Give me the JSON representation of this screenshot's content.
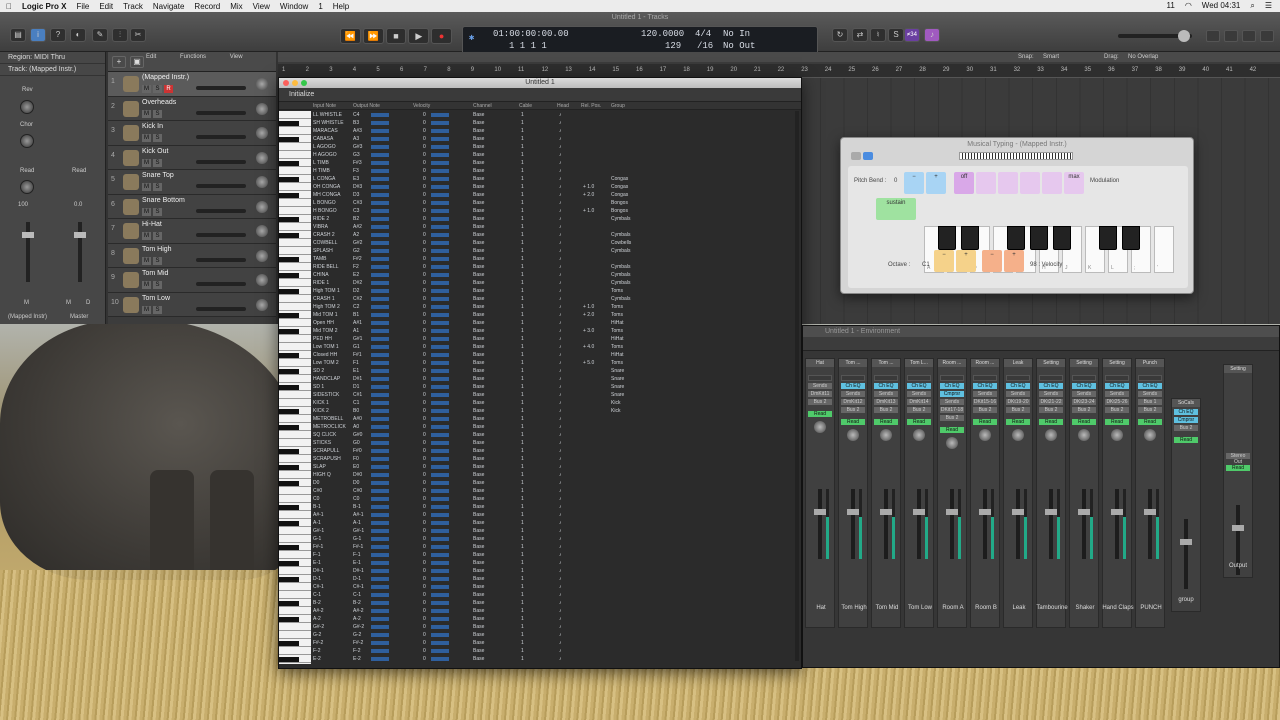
{
  "menubar": {
    "app": "Logic Pro X",
    "items": [
      "File",
      "Edit",
      "Track",
      "Navigate",
      "Record",
      "Mix",
      "View",
      "Window",
      "1",
      "Help"
    ],
    "clock": "Wed 04:31",
    "battery": "11"
  },
  "window_title": "Untitled 1 - Tracks",
  "lcd": {
    "time": "01:00:00:00.00",
    "bars": "1  1  1     1",
    "tempo": "120.0000",
    "division": "129",
    "signature": "4/4",
    "signature_den": "/16",
    "in": "No In",
    "out": "No Out"
  },
  "toolbar": {
    "count": "≠34"
  },
  "transport": [
    "⏪",
    "⏩",
    "■",
    "▶",
    "●"
  ],
  "inspector": {
    "region": "Region: MIDI Thru",
    "track": "Track: (Mapped Instr.)",
    "rev": "Rev",
    "chor": "Chor",
    "read1": "Read",
    "read2": "Read",
    "vol1": "100",
    "vol2": "0.0",
    "name1": "(Mapped Instr)",
    "name2": "Master",
    "m1": "M",
    "m2": "M",
    "d2": "D"
  },
  "arrange_menu": [
    "Edit",
    "Functions",
    "View"
  ],
  "snap": "Snap:",
  "snap_value": "Smart",
  "drag": "Drag:",
  "drag_value": "No Overlap",
  "ruler": [
    "1",
    "2",
    "3",
    "4",
    "5",
    "6",
    "7",
    "8",
    "9",
    "10",
    "11",
    "12",
    "13",
    "14",
    "15",
    "16",
    "17",
    "18",
    "19",
    "20",
    "21",
    "22",
    "23",
    "24",
    "25",
    "26",
    "27",
    "28",
    "29",
    "30",
    "31",
    "32",
    "33",
    "34",
    "35",
    "36",
    "37",
    "38",
    "39",
    "40",
    "41",
    "42"
  ],
  "tracks": [
    {
      "num": "1",
      "name": "(Mapped Instr.)"
    },
    {
      "num": "2",
      "name": "Overheads"
    },
    {
      "num": "3",
      "name": "Kick In"
    },
    {
      "num": "4",
      "name": "Kick Out"
    },
    {
      "num": "5",
      "name": "Snare Top"
    },
    {
      "num": "6",
      "name": "Snare Bottom"
    },
    {
      "num": "7",
      "name": "Hi-Hat"
    },
    {
      "num": "8",
      "name": "Tom High"
    },
    {
      "num": "9",
      "name": "Tom Mid"
    },
    {
      "num": "10",
      "name": "Tom Low"
    }
  ],
  "mapped": {
    "title": "Untitled 1",
    "init": "Initialize",
    "columns": [
      "Input Note",
      "Output Note",
      "Velocity",
      "Channel",
      "Cable",
      "Head",
      "Rel. Pos.",
      "Group"
    ],
    "rows": [
      [
        "LL WHISTLE",
        "C4",
        "Base"
      ],
      [
        "SH WHISTLE",
        "B3",
        "Base"
      ],
      [
        "MARACAS",
        "A#3",
        "Base"
      ],
      [
        "CABASA",
        "A3",
        "Base"
      ],
      [
        "L AGOGO",
        "G#3",
        "Base"
      ],
      [
        "H AGOGO",
        "G3",
        "Base"
      ],
      [
        "L TIMB",
        "F#3",
        "Base"
      ],
      [
        "H TIMB",
        "F3",
        "Base"
      ],
      [
        "L CONGA",
        "E3",
        "Base",
        "",
        "Congas"
      ],
      [
        "OH CONGA",
        "D#3",
        "Base",
        "+ 1.0",
        "Congas"
      ],
      [
        "MH CONGA",
        "D3",
        "Base",
        "+ 2.0",
        "Congas"
      ],
      [
        "L BONGO",
        "C#3",
        "Base",
        "",
        "Bongos"
      ],
      [
        "H BONGO",
        "C3",
        "Base",
        "+ 1.0",
        "Bongos"
      ],
      [
        "RIDE 2",
        "B2",
        "Base",
        "",
        "Cymbals"
      ],
      [
        "VIBRA",
        "A#2",
        "Base"
      ],
      [
        "CRASH 2",
        "A2",
        "Base",
        "",
        "Cymbals"
      ],
      [
        "COWBELL",
        "G#2",
        "Base",
        "",
        "Cowbells"
      ],
      [
        "SPLASH",
        "G2",
        "Base",
        "",
        "Cymbals"
      ],
      [
        "TAMB",
        "F#2",
        "Base"
      ],
      [
        "RIDE BELL",
        "F2",
        "Base",
        "",
        "Cymbals"
      ],
      [
        "CHINA",
        "E2",
        "Base",
        "",
        "Cymbals"
      ],
      [
        "RIDE 1",
        "D#2",
        "Base",
        "",
        "Cymbals"
      ],
      [
        "High TOM 1",
        "D2",
        "Base",
        "",
        "Toms"
      ],
      [
        "CRASH 1",
        "C#2",
        "Base",
        "",
        "Cymbals"
      ],
      [
        "High TOM 2",
        "C2",
        "Base",
        "+ 1.0",
        "Toms"
      ],
      [
        "Mid TOM 1",
        "B1",
        "Base",
        "+ 2.0",
        "Toms"
      ],
      [
        "Open HH",
        "A#1",
        "Base",
        "",
        "HiHat"
      ],
      [
        "Mid TOM 2",
        "A1",
        "Base",
        "+ 3.0",
        "Toms"
      ],
      [
        "PED HH",
        "G#1",
        "Base",
        "",
        "HiHat"
      ],
      [
        "Low TOM 1",
        "G1",
        "Base",
        "+ 4.0",
        "Toms"
      ],
      [
        "Closed HH",
        "F#1",
        "Base",
        "",
        "HiHat"
      ],
      [
        "Low TOM 2",
        "F1",
        "Base",
        "+ 5.0",
        "Toms"
      ],
      [
        "SD 2",
        "E1",
        "Base",
        "",
        "Snare"
      ],
      [
        "HANDCLAP",
        "D#1",
        "Base",
        "",
        "Snare"
      ],
      [
        "SD 1",
        "D1",
        "Base",
        "",
        "Snare"
      ],
      [
        "SIDESTICK",
        "C#1",
        "Base",
        "",
        "Snare"
      ],
      [
        "KICK 1",
        "C1",
        "Base",
        "",
        "Kick"
      ],
      [
        "KICK 2",
        "B0",
        "Base",
        "",
        "Kick"
      ],
      [
        "METROBELL",
        "A#0",
        "Base"
      ],
      [
        "METROCLICK",
        "A0",
        "Base"
      ],
      [
        "SQ CLICK",
        "G#0",
        "Base"
      ],
      [
        "STICKS",
        "G0",
        "Base"
      ],
      [
        "SCRAPULL",
        "F#0",
        "Base"
      ],
      [
        "SCRAPUSH",
        "F0",
        "Base"
      ],
      [
        "SLAP",
        "E0",
        "Base"
      ],
      [
        "HIGH Q",
        "D#0",
        "Base"
      ],
      [
        "D0",
        "D0",
        "Base"
      ],
      [
        "C#0",
        "C#0",
        "Base"
      ],
      [
        "C0",
        "C0",
        "Base"
      ],
      [
        "B-1",
        "B-1",
        "Base"
      ],
      [
        "A#-1",
        "A#-1",
        "Base"
      ],
      [
        "A-1",
        "A-1",
        "Base"
      ],
      [
        "G#-1",
        "G#-1",
        "Base"
      ],
      [
        "G-1",
        "G-1",
        "Base"
      ],
      [
        "F#-1",
        "F#-1",
        "Base"
      ],
      [
        "F-1",
        "F-1",
        "Base"
      ],
      [
        "E-1",
        "E-1",
        "Base"
      ],
      [
        "D#-1",
        "D#-1",
        "Base"
      ],
      [
        "D-1",
        "D-1",
        "Base"
      ],
      [
        "C#-1",
        "C#-1",
        "Base"
      ],
      [
        "C-1",
        "C-1",
        "Base"
      ],
      [
        "B-2",
        "B-2",
        "Base"
      ],
      [
        "A#-2",
        "A#-2",
        "Base"
      ],
      [
        "A-2",
        "A-2",
        "Base"
      ],
      [
        "G#-2",
        "G#-2",
        "Base"
      ],
      [
        "G-2",
        "G-2",
        "Base"
      ],
      [
        "F#-2",
        "F#-2",
        "Base"
      ],
      [
        "F-2",
        "F-2",
        "Base"
      ],
      [
        "E-2",
        "E-2",
        "Base"
      ]
    ],
    "zero": "0",
    "one": "1"
  },
  "musical": {
    "title": "Musical Typing - (Mapped Instr.)",
    "pitch_bend": "Pitch Bend :",
    "pitch_val": "0",
    "modulation": "Modulation",
    "sustain": "sustain",
    "octave": "Octave :",
    "octave_val": "C1",
    "velocity": "98 : Velocity",
    "off": "off",
    "max": "max",
    "keys": [
      "A",
      "S",
      "D",
      "F",
      "G",
      "H",
      "J",
      "K",
      "L",
      ";",
      "'"
    ]
  },
  "env": {
    "title": "Untitled 1 - Environment",
    "strips": [
      {
        "hdr": "Hat",
        "io": "DmKit11",
        "name": "Hat"
      },
      {
        "hdr": "Tom ...",
        "io": "DmKit12",
        "name": "Tom High"
      },
      {
        "hdr": "Tom ...",
        "io": "DmKit13",
        "name": "Tom Mid"
      },
      {
        "hdr": "Tom L...",
        "io": "DmKit14",
        "name": "Tom Low"
      },
      {
        "hdr": "Room ...",
        "io": "DKit17-18",
        "name": "Room A"
      },
      {
        "hdr": "Room ...",
        "io": "DKit15-16",
        "name": "Room B"
      },
      {
        "hdr": "Leak",
        "io": "DKt19-20",
        "name": "Leak"
      },
      {
        "hdr": "Setting",
        "io": "DKt21-22",
        "name": "Tambourine"
      },
      {
        "hdr": "Setting",
        "io": "DKt23-24",
        "name": "Shaker"
      },
      {
        "hdr": "Setting",
        "io": "DKt25-26",
        "name": "Hand Claps"
      },
      {
        "hdr": "Punch",
        "io": "Bus 1",
        "name": "PUNCH"
      }
    ],
    "group_hdr": "SoCals",
    "group_name": "group",
    "out_hdr": "Setting",
    "out_label": "Stereo Out",
    "out_name": "Output",
    "insert_eq": "Ch EQ",
    "insert_comp": "Cmprsr",
    "read": "Read",
    "sends": "Sends",
    "io_label": "I/O",
    "bus": "Bus 2"
  },
  "colors": {
    "accent_blue": "#2f5f9d",
    "read_green": "#4fca6a",
    "insert_cyan": "#5fc0e0",
    "record_red": "#e33333"
  }
}
